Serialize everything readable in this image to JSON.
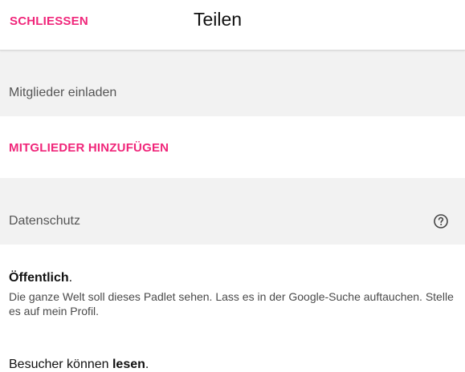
{
  "header": {
    "close_label": "SCHLIESSEN",
    "title": "Teilen"
  },
  "invite": {
    "section_label": "Mitglieder einladen",
    "add_members_label": "MITGLIEDER HINZUFÜGEN"
  },
  "privacy": {
    "section_label": "Datenschutz",
    "help_icon": "question-circle-icon",
    "mode_label": "Öffentlich",
    "mode_suffix": ".",
    "description": "Die ganze Welt soll dieses Padlet sehen. Lass es in der Google-Suche auftauchen. Stelle es auf mein Profil.",
    "visitors_prefix": "Besucher können ",
    "visitors_permission": "lesen",
    "visitors_suffix": "."
  },
  "colors": {
    "accent": "#f0267a",
    "section_bg": "#f2f2f2"
  }
}
